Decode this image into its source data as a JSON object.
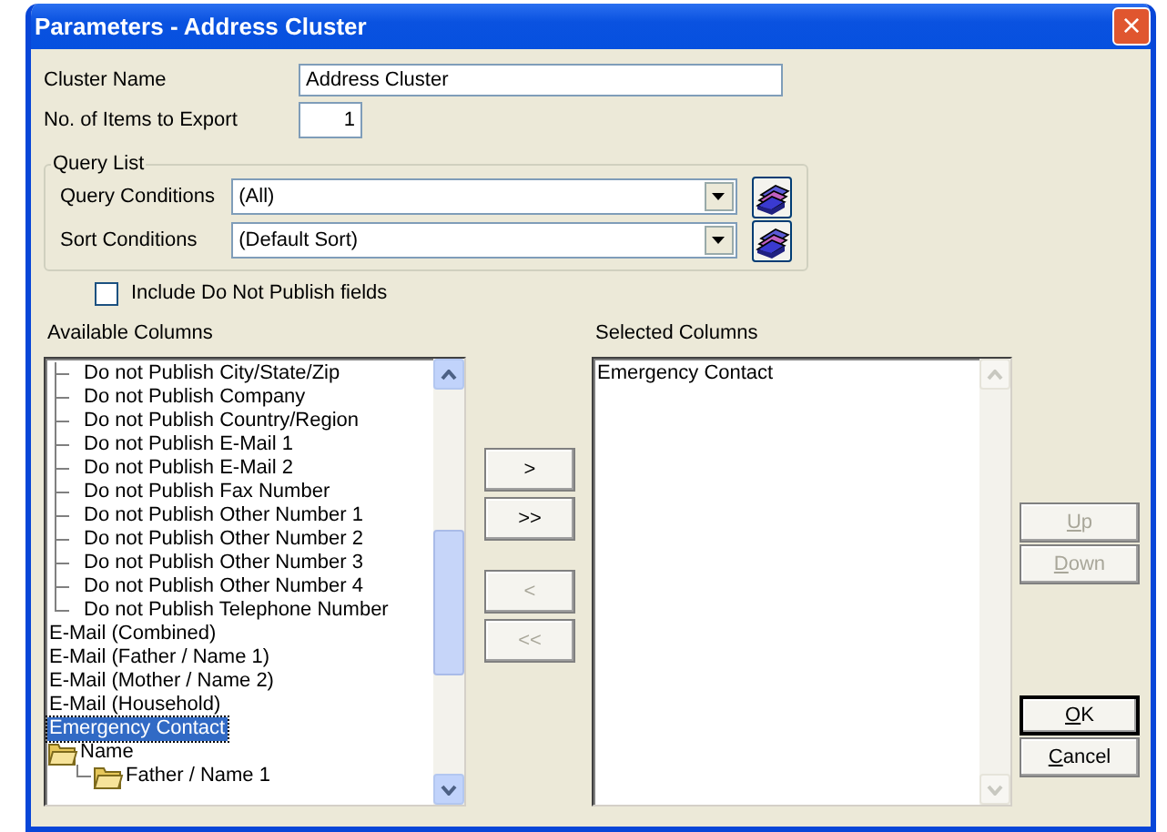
{
  "window": {
    "title": "Parameters - Address Cluster",
    "close_glyph": "×"
  },
  "fields": [
    {
      "label": "Cluster Name",
      "value": "Address Cluster",
      "kind": "text"
    },
    {
      "label": "No. of Items to Export",
      "value": "1",
      "kind": "number"
    }
  ],
  "query_list": {
    "title": "Query List",
    "rows": [
      {
        "label": "Query Conditions",
        "value": "(All)"
      },
      {
        "label": "Sort Conditions",
        "value": "(Default Sort)"
      }
    ]
  },
  "include_do_not_publish": {
    "label": "Include Do Not Publish fields",
    "checked": false
  },
  "available_columns": {
    "label": "Available Columns",
    "items": [
      {
        "kind": "continuation",
        "children": [
          {
            "label": "Do not Publish City/State/Zip",
            "selected": false
          },
          {
            "label": "Do not Publish Company",
            "selected": false
          },
          {
            "label": "Do not Publish Country/Region",
            "selected": false
          },
          {
            "label": "Do not Publish E-Mail 1",
            "selected": false
          },
          {
            "label": "Do not Publish E-Mail 2",
            "selected": false
          },
          {
            "label": "Do not Publish Fax Number",
            "selected": false
          },
          {
            "label": "Do not Publish Other Number 1",
            "selected": false
          },
          {
            "label": "Do not Publish Other Number 2",
            "selected": false
          },
          {
            "label": "Do not Publish Other Number 3",
            "selected": false
          },
          {
            "label": "Do not Publish Other Number 4",
            "selected": false
          },
          {
            "label": "Do not Publish Telephone Number",
            "selected": false
          }
        ]
      },
      {
        "kind": "field",
        "label": "E-Mail (Combined)",
        "selected": false
      },
      {
        "kind": "field",
        "label": "E-Mail (Father / Name 1)",
        "selected": false
      },
      {
        "kind": "field",
        "label": "E-Mail (Mother / Name 2)",
        "selected": false
      },
      {
        "kind": "field",
        "label": "E-Mail (Household)",
        "selected": false
      },
      {
        "kind": "field",
        "label": "Emergency Contact",
        "selected": true
      },
      {
        "kind": "folder",
        "label": "Name",
        "selected": false,
        "children": [
          {
            "kind": "folder",
            "label": "Father / Name 1",
            "selected": false
          }
        ]
      }
    ]
  },
  "move_buttons": [
    {
      "label": ">",
      "disabled": false
    },
    {
      "label": ">>",
      "disabled": false
    },
    {
      "label": "<",
      "disabled": true
    },
    {
      "label": "<<",
      "disabled": true
    }
  ],
  "selected_columns": {
    "label": "Selected Columns",
    "items": [
      {
        "label": "Emergency Contact",
        "selected": false
      }
    ]
  },
  "order_buttons": [
    {
      "label": "Up",
      "disabled": true
    },
    {
      "label": "Down",
      "disabled": true
    }
  ],
  "dialog_buttons": [
    {
      "label": "OK",
      "default": true
    },
    {
      "label": "Cancel",
      "default": false
    }
  ]
}
